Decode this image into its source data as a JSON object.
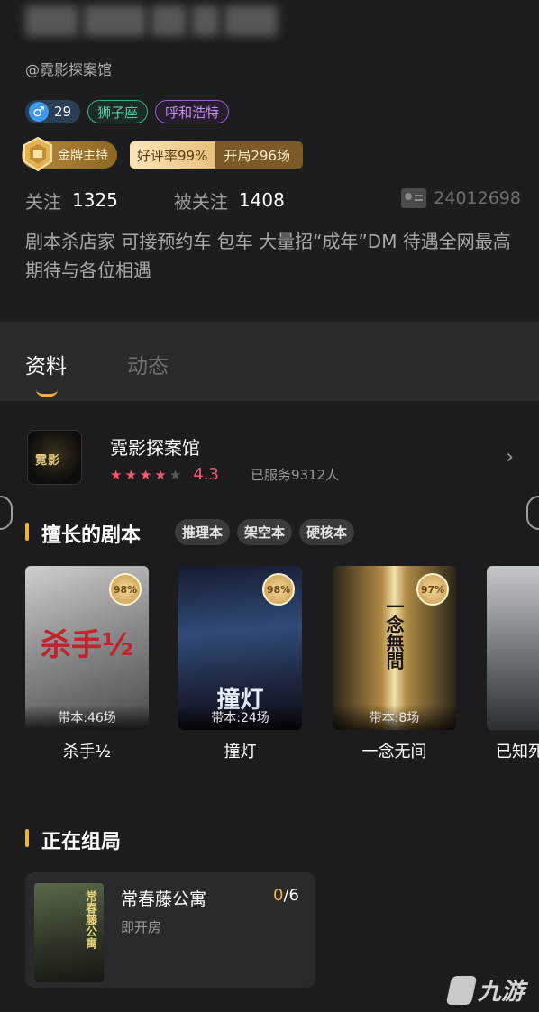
{
  "profile": {
    "handle": "@霓影探案馆",
    "age": "29",
    "zodiac": "狮子座",
    "city": "呼和浩特",
    "gold_badge": "金牌主持",
    "rating_label": "好评率99%",
    "sessions_label": "开局296场",
    "following_label": "关注",
    "following_count": "1325",
    "followers_label": "被关注",
    "followers_count": "1408",
    "user_id": "24012698",
    "bio": "剧本杀店家 可接预约车 包车 大量招“成年”DM 待遇全网最高 期待与各位相遇"
  },
  "tabs": {
    "active": "资料",
    "inactive": "动态"
  },
  "store": {
    "name": "霓影探案馆",
    "rating": "4.3",
    "served": "已服务9312人",
    "stars_filled": 4,
    "stars_total": 5,
    "logo_text": "霓影"
  },
  "skills": {
    "title": "擅长的剧本",
    "chips": [
      "推理本",
      "架空本",
      "硬核本"
    ],
    "scripts": [
      {
        "name": "杀手½",
        "count": "带本:46场",
        "pct": "98%",
        "art": "杀手½"
      },
      {
        "name": "撞灯",
        "count": "带本:24场",
        "pct": "98%",
        "art": "撞灯"
      },
      {
        "name": "一念无间",
        "count": "带本:8场",
        "pct": "97%",
        "art": "一念無間"
      },
      {
        "name": "已知死",
        "count": "",
        "pct": "",
        "art": ""
      }
    ]
  },
  "grouping": {
    "title": "正在组局",
    "item": {
      "name": "常春藤公寓",
      "current": "0",
      "total": "/6",
      "status": "即开房",
      "poster_text": "常春藤公寓"
    }
  },
  "watermark": {
    "text": "九游"
  },
  "colors": {
    "accent": "#f0b43c",
    "star": "#f25a6a",
    "background": "#1c1c1e"
  }
}
